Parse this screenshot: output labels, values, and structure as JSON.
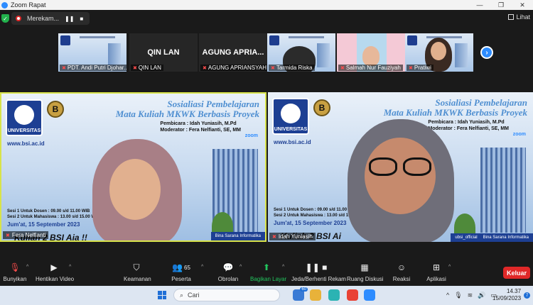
{
  "window": {
    "title": "Zoom Rapat"
  },
  "topbar": {
    "recording_label": "Merekam...",
    "view_label": "Lihat"
  },
  "thumbnails": [
    {
      "name": "PDT. Andi Putri Djohar..."
    },
    {
      "name": "QIN LAN",
      "display": "QIN LAN"
    },
    {
      "name": "AGUNG APRIANSYAH",
      "display": "AGUNG  APRIA..."
    },
    {
      "name": "Tarmida Riska"
    },
    {
      "name": "Salmah Nur Fauziyah"
    },
    {
      "name": "Pratiwi"
    }
  ],
  "slide": {
    "title_line1": "Sosialiasi Pembelajaran",
    "title_line2": "Mata Kuliah MKWK Berbasis Proyek",
    "logo_text": "UNIVERSITAS",
    "website": "www.bsi.ac.id",
    "speaker": "Pembicara : Idah Yuniasih, M.Pd",
    "moderator": "Moderator : Fera Nelfianti, SE, MM",
    "zoom": "zoom",
    "session1": "Sesi 1 Untuk Dosen : 09.00 s/d 11.00 WIB",
    "session2": "Sesi 2 Untuk Mahasiswa : 13.00 s/d 15.00 WIB",
    "date": "Jum'at, 15 September 2023",
    "tagline": "Kuliah   2 BSI Aja !!",
    "tagline_right": "Kuliah   2 BSI Ai",
    "footer_social": "ubsi_official",
    "footer_brand": "Bina Sarana Informatika"
  },
  "tiles": {
    "left_name": "Fera Nelfianti",
    "right_name": "Idah Yuniasih"
  },
  "toolbar": {
    "mute": "Bunyikan",
    "video": "Hentikan Video",
    "security": "Keamanan",
    "participants": "Peserta",
    "participants_count": "65",
    "chat": "Obrolan",
    "share": "Bagikan Layar",
    "record": "Jeda/Berhenti Rekam",
    "breakout": "Ruang Diskusi",
    "reactions": "Reaksi",
    "apps": "Aplikasi",
    "leave": "Keluar"
  },
  "taskbar": {
    "search_placeholder": "Cari",
    "badge_count": "60",
    "time": "14.37",
    "date": "15/09/2023",
    "notif_count": "7"
  },
  "colors": {
    "accent": "#2d8cff",
    "leave": "#e02828",
    "share": "#22c55e",
    "active_border": "#d8e34a"
  }
}
